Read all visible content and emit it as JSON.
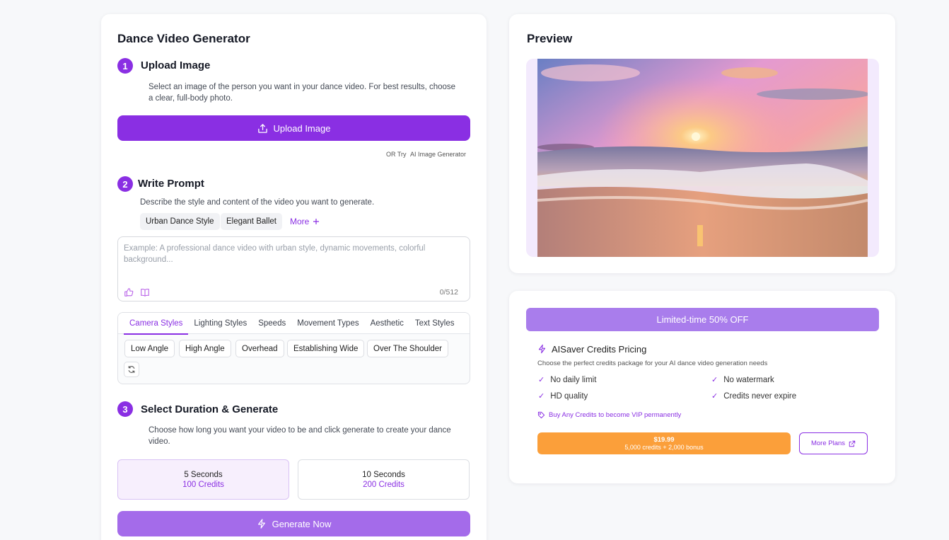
{
  "generator": {
    "title": "Dance Video Generator",
    "step1": {
      "number": "1",
      "title": "Upload Image",
      "description": "Select an image of the person you want in your dance video. For best results, choose a clear, full-body photo.",
      "upload_button": "Upload Image",
      "or_try_label": "OR Try",
      "or_try_link": "AI Image Generator"
    },
    "step2": {
      "number": "2",
      "title": "Write Prompt",
      "description": "Describe the style and content of the video you want to generate.",
      "prompt_chips": [
        "Urban Dance Style",
        "Elegant Ballet"
      ],
      "more_label": "More",
      "prompt_placeholder": "Example: A professional dance video with urban style, dynamic movements, colorful background...",
      "prompt_value": "",
      "counter": "0/512",
      "style_tabs": [
        "Camera Styles",
        "Lighting Styles",
        "Speeds",
        "Movement Types",
        "Aesthetic",
        "Text Styles"
      ],
      "active_tab": "Camera Styles",
      "style_options": [
        "Low Angle",
        "High Angle",
        "Overhead",
        "Establishing Wide",
        "Over The Shoulder"
      ]
    },
    "step3": {
      "number": "3",
      "title": "Select Duration & Generate",
      "description": "Choose how long you want your video to be and click generate to create your dance video.",
      "durations": [
        {
          "label": "5 Seconds",
          "credits": "100 Credits",
          "selected": true
        },
        {
          "label": "10 Seconds",
          "credits": "200 Credits",
          "selected": false
        }
      ],
      "generate_button": "Generate Now"
    }
  },
  "preview": {
    "title": "Preview"
  },
  "pricing": {
    "promo_banner": "Limited-time 50% OFF",
    "title": "AISaver Credits Pricing",
    "description": "Choose the perfect credits package for your AI dance video generation needs",
    "features": [
      "No daily limit",
      "No watermark",
      "HD quality",
      "Credits never expire"
    ],
    "vip_note": "Buy Any Credits to become VIP permanently",
    "price": "$19.99",
    "price_detail": "5,000 credits + 2,000 bonus",
    "more_plans": "More Plans"
  },
  "colors": {
    "accent": "#8a2fe3",
    "accent_light": "#a46bea",
    "price_button": "#fb9f3a",
    "background": "#f7f8fa"
  },
  "icons": [
    "upload-icon",
    "plus-icon",
    "thumbs-up-icon",
    "book-icon",
    "refresh-icon",
    "lightning-icon",
    "check-icon",
    "tag-icon",
    "external-link-icon"
  ]
}
